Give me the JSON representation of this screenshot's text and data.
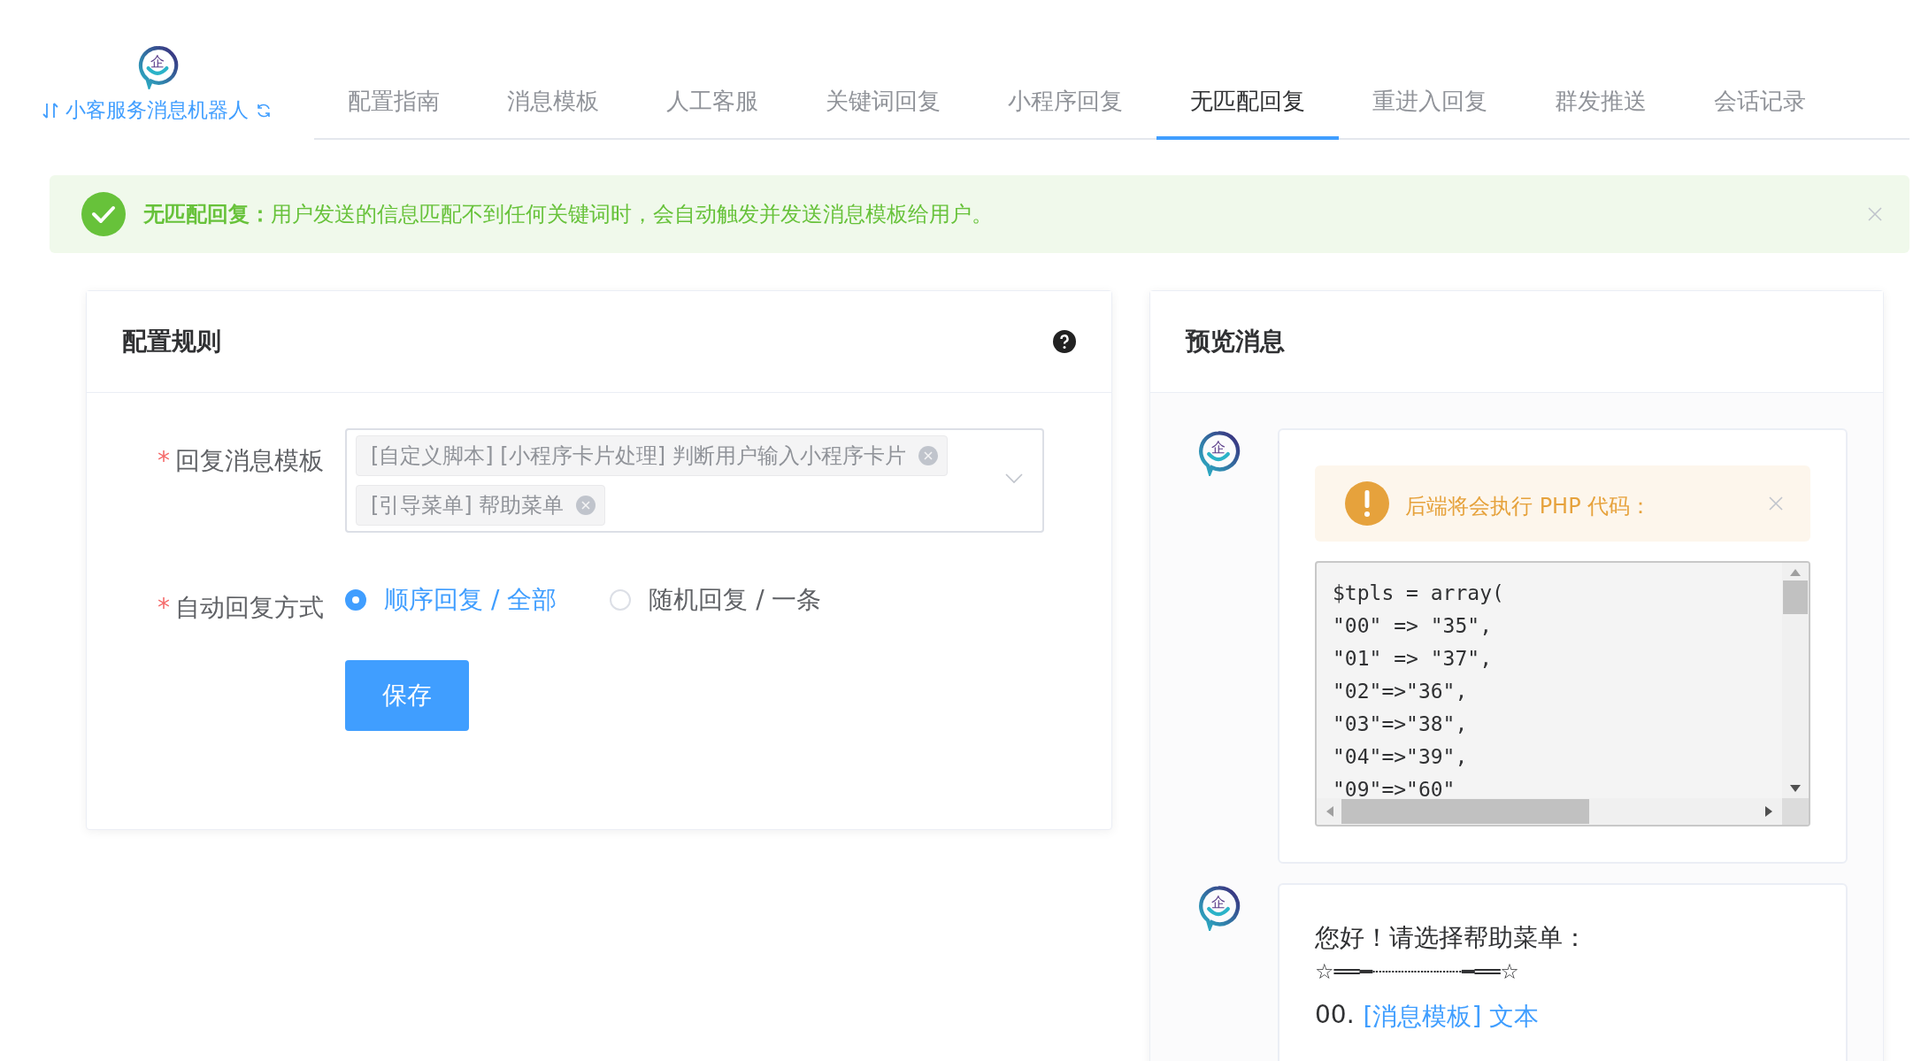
{
  "brand": {
    "logo_glyph": "企",
    "title": "小客服务消息机器人"
  },
  "tabs": [
    {
      "label": "配置指南",
      "selected": false
    },
    {
      "label": "消息模板",
      "selected": false
    },
    {
      "label": "人工客服",
      "selected": false
    },
    {
      "label": "关键词回复",
      "selected": false
    },
    {
      "label": "小程序回复",
      "selected": false
    },
    {
      "label": "无匹配回复",
      "selected": true
    },
    {
      "label": "重进入回复",
      "selected": false
    },
    {
      "label": "群发推送",
      "selected": false
    },
    {
      "label": "会话记录",
      "selected": false
    }
  ],
  "alert": {
    "title": "无匹配回复：",
    "message": "用户发送的信息匹配不到任何关键词时，会自动触发并发送消息模板给用户。"
  },
  "config_card": {
    "title": "配置规则",
    "fields": [
      {
        "kind": "select",
        "label": "回复消息模板",
        "required_mark": "*",
        "tags": [
          "[自定义脚本] [小程序卡片处理] 判断用户输入小程序卡片",
          "[引导菜单] 帮助菜单"
        ]
      },
      {
        "kind": "radio",
        "label": "自动回复方式",
        "required_mark": "*",
        "options": [
          {
            "label": "顺序回复 / 全部",
            "selected": true
          },
          {
            "label": "随机回复 / 一条",
            "selected": false
          }
        ]
      }
    ],
    "save_button": "保存"
  },
  "preview_card": {
    "title": "预览消息",
    "messages": [
      {
        "kind": "code",
        "avatar_glyph": "企",
        "warning": "后端将会执行 PHP 代码：",
        "code_lines": [
          "$tpls = array(",
          "\"00\" => \"35\",",
          "\"01\" => \"37\",",
          "\"02\"=>\"36\",",
          "\"03\"=>\"38\",",
          "\"04\"=>\"39\",",
          "\"09\"=>\"60\""
        ]
      },
      {
        "kind": "text",
        "avatar_glyph": "企",
        "greeting": "您好！请选择帮助菜单：",
        "divider": "☆══━┈┈┈┈┈┈┈━══☆",
        "items": [
          {
            "number": "00.",
            "link": "[消息模板] 文本"
          }
        ]
      }
    ]
  }
}
